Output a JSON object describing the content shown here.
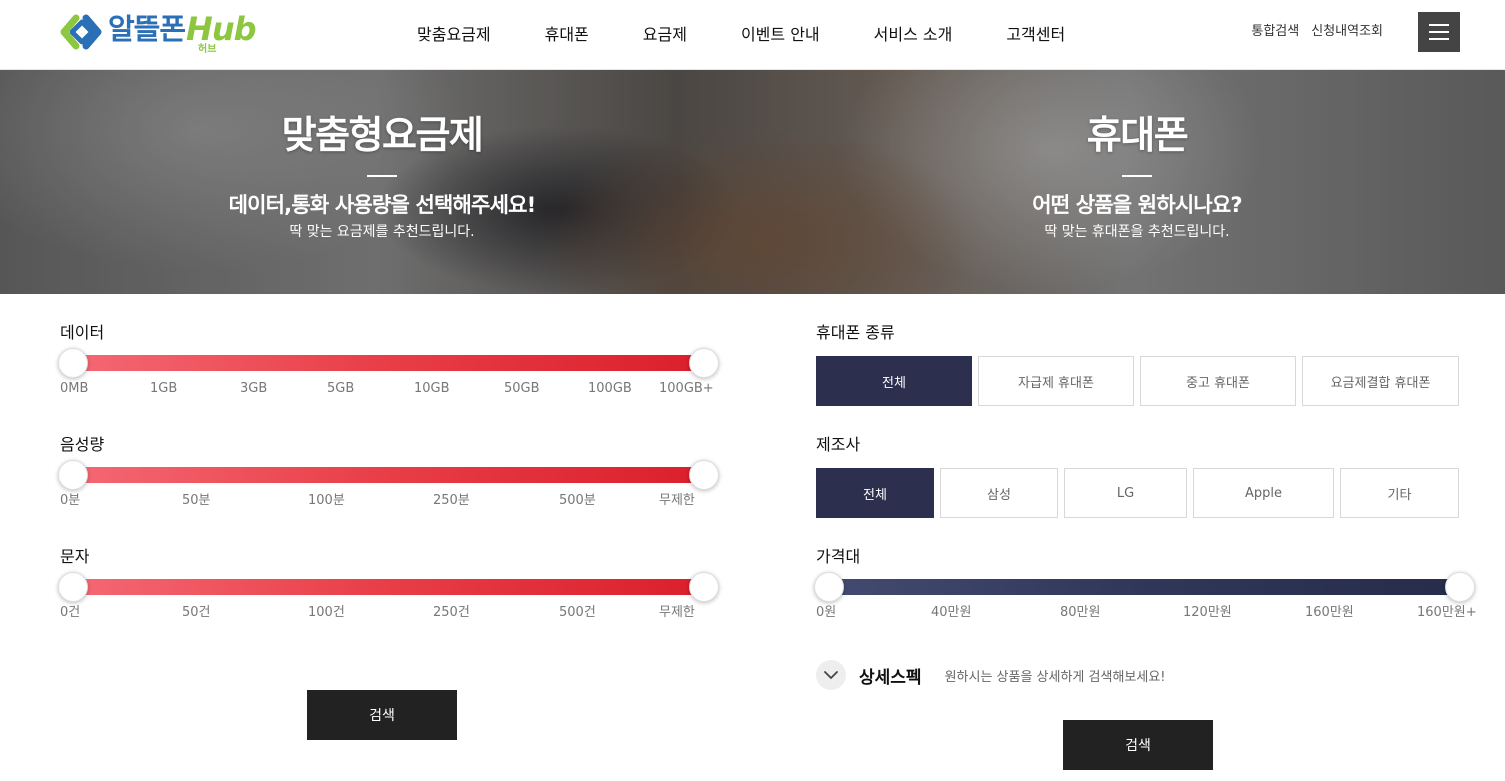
{
  "brand": {
    "name_ko": "알뜰폰",
    "name_en": "Hub",
    "name_sub": "허브",
    "color_blue": "#2b6fb6",
    "color_green": "#8dc63f"
  },
  "nav": {
    "items": [
      {
        "label": "맞춤요금제"
      },
      {
        "label": "휴대폰"
      },
      {
        "label": "요금제"
      },
      {
        "label": "이벤트 안내"
      },
      {
        "label": "서비스 소개"
      },
      {
        "label": "고객센터"
      }
    ]
  },
  "util": {
    "search": "통합검색",
    "apply_history": "신청내역조회",
    "menu_icon": "hamburger-menu-icon"
  },
  "hero": {
    "left": {
      "title": "맞춤형요금제",
      "subtitle": "데이터,통화 사용량을 선택해주세요!",
      "desc": "딱 맞는 요금제를 추천드립니다."
    },
    "right": {
      "title": "휴대폰",
      "subtitle": "어떤 상품을 원하시나요?",
      "desc": "딱 맞는 휴대폰을 추천드립니다."
    }
  },
  "plan": {
    "data": {
      "label": "데이터",
      "ticks": [
        "0MB",
        "1GB",
        "3GB",
        "5GB",
        "10GB",
        "50GB",
        "100GB",
        "100GB+"
      ]
    },
    "voice": {
      "label": "음성량",
      "ticks": [
        "0분",
        "50분",
        "100분",
        "250분",
        "500분",
        "무제한"
      ]
    },
    "sms": {
      "label": "문자",
      "ticks": [
        "0건",
        "50건",
        "100건",
        "250건",
        "500건",
        "무제한"
      ]
    },
    "search_label": "검색"
  },
  "phone": {
    "type": {
      "label": "휴대폰 종류",
      "options": [
        "전체",
        "자급제 휴대폰",
        "중고 휴대폰",
        "요금제결합 휴대폰"
      ],
      "selected": "전체"
    },
    "maker": {
      "label": "제조사",
      "options": [
        "전체",
        "삼성",
        "LG",
        "Apple",
        "기타"
      ],
      "selected": "전체"
    },
    "price": {
      "label": "가격대",
      "ticks": [
        "0원",
        "40만원",
        "80만원",
        "120만원",
        "160만원",
        "160만원+"
      ]
    },
    "detail": {
      "title": "상세스펙",
      "desc": "원하시는 상품을 상세하게 검색해보세요!",
      "icon": "chevron-down-icon"
    },
    "search_label": "검색"
  },
  "colors": {
    "accent_red": "#e0242f",
    "accent_navy": "#2c2f4e",
    "button_dark": "#222222"
  }
}
